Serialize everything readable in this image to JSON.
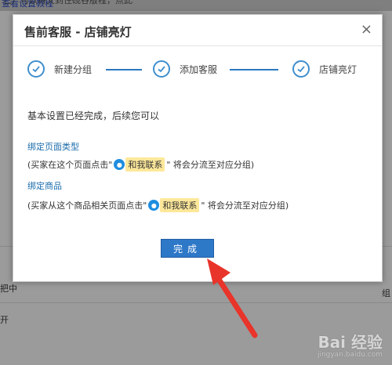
{
  "background": {
    "top_text": "己）可以将父到住砚谷版程，点此",
    "top_link": "查看设置教程",
    "left_fragment_1": "把中",
    "left_fragment_2": "开",
    "right_fragment": "组",
    "watermark_main": "Bai 经验",
    "watermark_sub": "jingyan.baidu.com"
  },
  "dialog": {
    "title": "售前客服 - 店铺亮灯",
    "close_label": "×",
    "steps": [
      {
        "label": "新建分组",
        "icon": "check-circle-icon"
      },
      {
        "label": "添加客服",
        "icon": "check-circle-icon"
      },
      {
        "label": "店铺亮灯",
        "icon": "check-circle-icon"
      }
    ],
    "summary": "基本设置已经完成，后续您可以",
    "sections": [
      {
        "title": "绑定页面类型",
        "desc_prefix": "(买家在这个页面点击\"",
        "badge": "和我联系",
        "desc_suffix": "\" 将会分流至对应分组)"
      },
      {
        "title": "绑定商品",
        "desc_prefix": "(买家从这个商品相关页面点击\"",
        "badge": "和我联系",
        "desc_suffix": "\" 将会分流至对应分组)"
      }
    ],
    "done_label": "完成"
  },
  "colors": {
    "accent": "#2e78c8",
    "step_blue": "#3f8fce",
    "section_title": "#1a6bab",
    "badge_bg": "#fde89a",
    "arrow_red": "#e8342a"
  }
}
